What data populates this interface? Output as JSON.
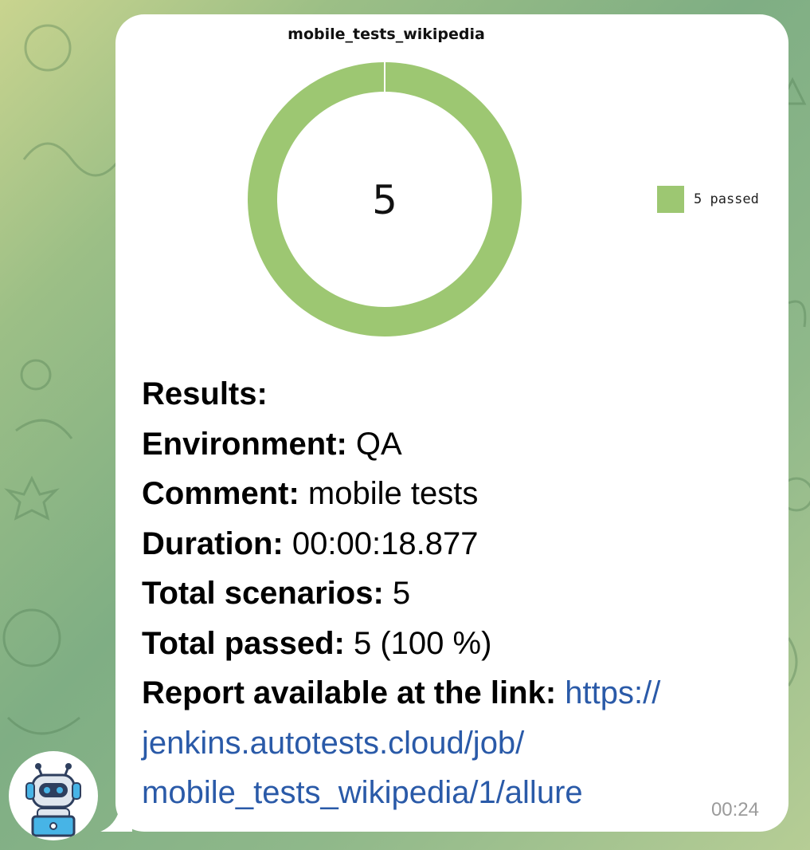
{
  "chart_data": {
    "type": "pie",
    "title": "mobile_tests_wikipedia",
    "center_label": "5",
    "slices": [
      {
        "name": "5 passed",
        "value": 5,
        "color": "#9dc772"
      }
    ]
  },
  "message": {
    "results_label": "Results:",
    "environment_label": "Environment:",
    "environment_value": " QA",
    "comment_label": "Comment:",
    "comment_value": " mobile tests",
    "duration_label": "Duration:",
    "duration_value": " 00:00:18.877",
    "total_scenarios_label": "Total scenarios:",
    "total_scenarios_value": " 5",
    "total_passed_label": "Total passed:",
    "total_passed_value": " 5 (100 %)",
    "report_label": "Report available at the link:",
    "report_link_line1": " https://",
    "report_link_line2": "jenkins.autotests.cloud/job/",
    "report_link_line3": "mobile_tests_wikipedia/1/allure",
    "time": "00:24"
  },
  "colors": {
    "passed": "#9dc772",
    "link": "#2a5aa8",
    "bubble": "#ffffff"
  },
  "icons": {
    "avatar": "robot-headset-avatar-icon"
  }
}
